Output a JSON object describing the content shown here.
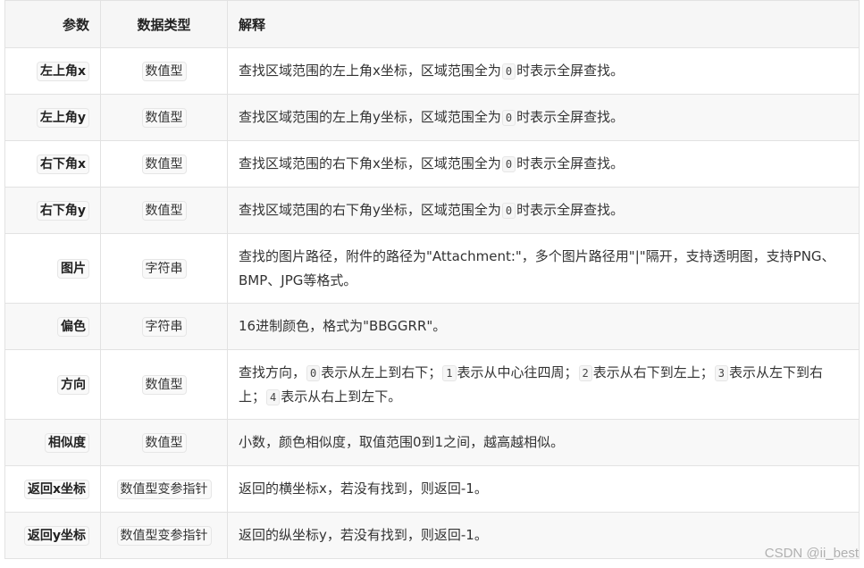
{
  "table": {
    "headers": {
      "param": "参数",
      "type": "数据类型",
      "desc": "解释"
    },
    "rows": [
      {
        "param": "左上角x",
        "type": "数值型",
        "desc": [
          {
            "t": "查找区域范围的左上角x坐标，区域范围全为"
          },
          {
            "c": "0"
          },
          {
            "t": "时表示全屏查找。"
          }
        ]
      },
      {
        "param": "左上角y",
        "type": "数值型",
        "desc": [
          {
            "t": "查找区域范围的左上角y坐标，区域范围全为"
          },
          {
            "c": "0"
          },
          {
            "t": "时表示全屏查找。"
          }
        ]
      },
      {
        "param": "右下角x",
        "type": "数值型",
        "desc": [
          {
            "t": "查找区域范围的右下角x坐标，区域范围全为"
          },
          {
            "c": "0"
          },
          {
            "t": "时表示全屏查找。"
          }
        ]
      },
      {
        "param": "右下角y",
        "type": "数值型",
        "desc": [
          {
            "t": "查找区域范围的右下角y坐标，区域范围全为"
          },
          {
            "c": "0"
          },
          {
            "t": "时表示全屏查找。"
          }
        ]
      },
      {
        "param": "图片",
        "type": "字符串",
        "desc": [
          {
            "t": "查找的图片路径，附件的路径为\"Attachment:\"，多个图片路径用\"|\"隔开，支持透明图，支持PNG、BMP、JPG等格式。"
          }
        ]
      },
      {
        "param": "偏色",
        "type": "字符串",
        "desc": [
          {
            "t": "16进制颜色，格式为\"BBGGRR\"。"
          }
        ]
      },
      {
        "param": "方向",
        "type": "数值型",
        "desc": [
          {
            "t": "查找方向，"
          },
          {
            "c": "0"
          },
          {
            "t": "表示从左上到右下；"
          },
          {
            "c": "1"
          },
          {
            "t": "表示从中心往四周；"
          },
          {
            "c": "2"
          },
          {
            "t": "表示从右下到左上；"
          },
          {
            "c": "3"
          },
          {
            "t": "表示从左下到右上；"
          },
          {
            "c": "4"
          },
          {
            "t": "表示从右上到左下。"
          }
        ]
      },
      {
        "param": "相似度",
        "type": "数值型",
        "desc": [
          {
            "t": "小数，颜色相似度，取值范围0到1之间，越高越相似。"
          }
        ]
      },
      {
        "param": "返回x坐标",
        "type": "数值型变参指针",
        "desc": [
          {
            "t": "返回的横坐标x，若没有找到，则返回-1。"
          }
        ]
      },
      {
        "param": "返回y坐标",
        "type": "数值型变参指针",
        "desc": [
          {
            "t": "返回的纵坐标y，若没有找到，则返回-1。"
          }
        ]
      }
    ]
  },
  "watermark": "CSDN @ii_best"
}
